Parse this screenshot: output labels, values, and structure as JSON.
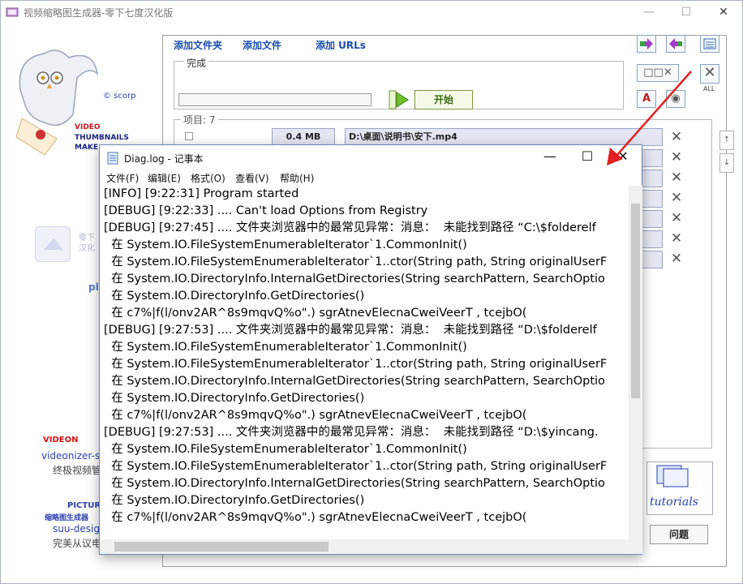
{
  "window": {
    "title": "视频缩略图生成器-零下七度汉化版",
    "min": "—",
    "max": "☐",
    "close": "✕"
  },
  "brand": {
    "scorp": "© scorp",
    "line1": "VIDEO",
    "line2": "THUMBNAILS",
    "line3": "MAKE",
    "update_text": "零下\n汉化",
    "update_pla": "pla",
    "vo_logo": "VIDEON",
    "vo_url": "videonizer-s",
    "vo_desc": "终极视频管",
    "pic_title": "PICTUR",
    "pic_sub": "缩略图生成器",
    "pic_url": "suu-design",
    "pic_desc": "完美从议电"
  },
  "toolbar": {
    "add_folder": "添加文件夹",
    "add_file": "添加文件",
    "add_urls": "添加 URLs",
    "progress_label": "完成",
    "start": "开始",
    "all": "ALL"
  },
  "list": {
    "label": "项目: 7",
    "row1_size": "0.4 MB",
    "row1_path": "D:\\桌面\\说明书\\安下.mp4"
  },
  "bottom": {
    "tutorials": "tutorials",
    "issue": "问题"
  },
  "notepad": {
    "title": "Diag.log - 记事本",
    "menu": [
      "文件(F)",
      "编辑(E)",
      "格式(O)",
      "查看(V)",
      "帮助(H)"
    ],
    "lines": [
      "[INFO] [9:22:31] Program started",
      "[DEBUG] [9:22:33] .... Can't load Options from Registry",
      "[DEBUG] [9:27:45] .... 文件夹浏览器中的最常见异常：消息：  未能找到路径 “C:\\$folderelf",
      "  在 System.IO.FileSystemEnumerableIterator`1.CommonInit()",
      "  在 System.IO.FileSystemEnumerableIterator`1..ctor(String path, String originalUserF",
      "  在 System.IO.DirectoryInfo.InternalGetDirectories(String searchPattern, SearchOptio",
      "  在 System.IO.DirectoryInfo.GetDirectories()",
      "  在 c7%|f(l/onv2AR^8s9mqvQ%o\".) sgrAtnevElecnaCweiVeerT , tcejbO(",
      "[DEBUG] [9:27:53] .... 文件夹浏览器中的最常见异常：消息：  未能找到路径 “D:\\$folderelf",
      "  在 System.IO.FileSystemEnumerableIterator`1.CommonInit()",
      "  在 System.IO.FileSystemEnumerableIterator`1..ctor(String path, String originalUserF",
      "  在 System.IO.DirectoryInfo.InternalGetDirectories(String searchPattern, SearchOptio",
      "  在 System.IO.DirectoryInfo.GetDirectories()",
      "  在 c7%|f(l/onv2AR^8s9mqvQ%o\".) sgrAtnevElecnaCweiVeerT , tcejbO(",
      "[DEBUG] [9:27:53] .... 文件夹浏览器中的最常见异常：消息：  未能找到路径 “D:\\$yincang.",
      "  在 System.IO.FileSystemEnumerableIterator`1.CommonInit()",
      "  在 System.IO.FileSystemEnumerableIterator`1..ctor(String path, String originalUserF",
      "  在 System.IO.DirectoryInfo.InternalGetDirectories(String searchPattern, SearchOptio",
      "  在 System.IO.DirectoryInfo.GetDirectories()",
      "  在 c7%|f(l/onv2AR^8s9mqvQ%o\".) sgrAtnevElecnaCweiVeerT , tcejbO("
    ],
    "min": "—",
    "max": "☐",
    "close": "✕"
  },
  "icons": {
    "app": "film-icon",
    "notepad": "notepad-icon",
    "delete": "x-icon",
    "arrow_up": "↑",
    "arrow_down": "↓"
  },
  "colors": {
    "link": "#1a4db0",
    "start_green": "#3c6b12",
    "annotation_red": "#e02020",
    "row_bg": "#e4e7f3"
  }
}
